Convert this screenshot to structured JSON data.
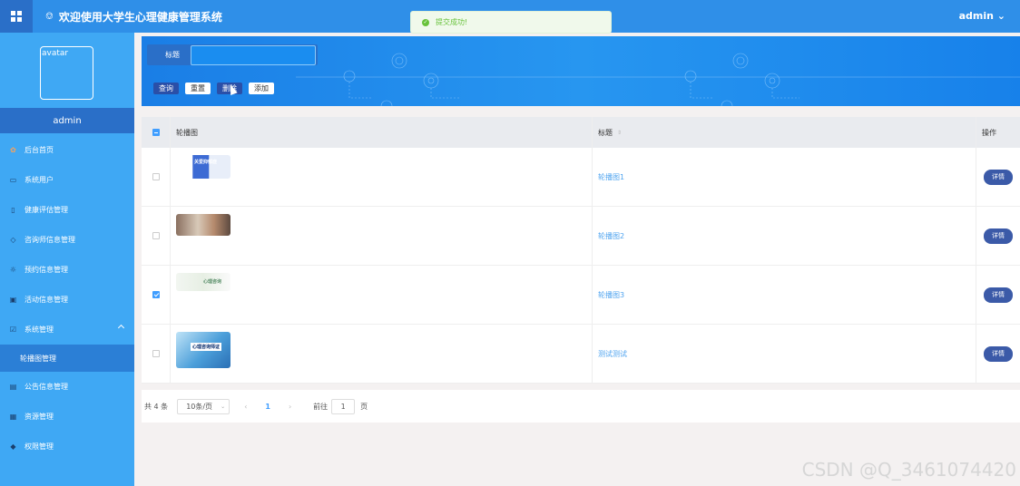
{
  "app": {
    "title": "欢迎使用大学生心理健康管理系统",
    "user": "admin ⌄"
  },
  "toast": {
    "message": "提交成功!"
  },
  "sidebar": {
    "avatar_alt": "avatar",
    "username": "admin",
    "items": [
      {
        "label": "后台首页",
        "icon": "home-icon"
      },
      {
        "label": "系统用户",
        "icon": "monitor-icon"
      },
      {
        "label": "健康评估管理",
        "icon": "bookmark-icon"
      },
      {
        "label": "咨询师信息管理",
        "icon": "tag-icon"
      },
      {
        "label": "预约信息管理",
        "icon": "sun-icon"
      },
      {
        "label": "活动信息管理",
        "icon": "inbox-icon"
      },
      {
        "label": "系统管理",
        "icon": "clipboard-icon"
      },
      {
        "label": "轮播图管理",
        "icon": ""
      },
      {
        "label": "公告信息管理",
        "icon": "message-icon"
      },
      {
        "label": "资源管理",
        "icon": "archive-icon"
      },
      {
        "label": "权限管理",
        "icon": "tag-icon"
      }
    ]
  },
  "search": {
    "label": "标题",
    "value": "",
    "buttons": {
      "query": "查询",
      "reset": "重置",
      "delete": "删除",
      "add": "添加"
    }
  },
  "table": {
    "headers": {
      "image": "轮播图",
      "title": "标题",
      "ops": "操作"
    },
    "rows": [
      {
        "title": "轮播图1",
        "checked": false,
        "detail": "详情",
        "thumb_text": "关爱抑郁症"
      },
      {
        "title": "轮播图2",
        "checked": false,
        "detail": "详情",
        "thumb_text": ""
      },
      {
        "title": "轮播图3",
        "checked": true,
        "detail": "详情",
        "thumb_text": "心理咨询"
      },
      {
        "title": "测试测试",
        "checked": false,
        "detail": "详情",
        "thumb_text": "心理咨询师证"
      }
    ]
  },
  "pager": {
    "total": "共 4 条",
    "page_size": "10条/页",
    "current_page": "1",
    "goto_label": "前往",
    "goto_value": "1",
    "page_unit": "页"
  },
  "watermark": "CSDN @Q_3461074420"
}
